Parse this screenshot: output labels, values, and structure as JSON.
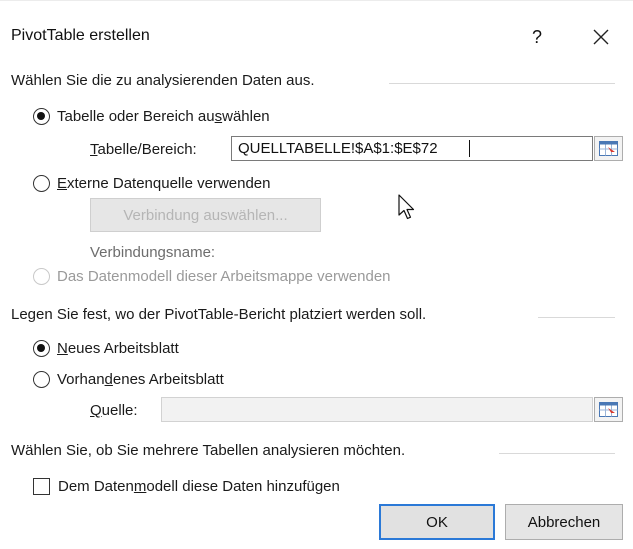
{
  "window": {
    "title": "PivotTable erstellen",
    "help_label": "?"
  },
  "section1": {
    "heading": "Wählen Sie die zu analysierenden Daten aus.",
    "option_table": {
      "label_pre": "Tabelle oder Bereich au",
      "label_ul": "s",
      "label_post": "wählen",
      "checked": true
    },
    "table_range": {
      "label_ul": "T",
      "label_post": "abelle/Bereich:",
      "value": "QUELLTABELLE!$A$1:$E$72"
    },
    "option_external": {
      "label_pre": "",
      "label_ul": "E",
      "label_post": "xterne Datenquelle verwenden",
      "checked": false
    },
    "choose_connection_label": "Verbindung auswählen...",
    "connection_name_label": "Verbindungsname:",
    "option_datamodel": {
      "label": "Das Datenmodell dieser Arbeitsmappe verwenden",
      "checked": false,
      "disabled": true
    }
  },
  "section2": {
    "heading": "Legen Sie fest, wo der PivotTable-Bericht platziert werden soll.",
    "option_new_sheet": {
      "label_pre": "",
      "label_ul": "N",
      "label_post": "eues Arbeitsblatt",
      "checked": true
    },
    "option_existing_sheet": {
      "label_pre": "Vorhan",
      "label_ul": "d",
      "label_post": "enes Arbeitsblatt",
      "checked": false
    },
    "source": {
      "label_ul": "Q",
      "label_post": "uelle:",
      "value": ""
    }
  },
  "section3": {
    "heading": "Wählen Sie, ob Sie mehrere Tabellen analysieren möchten.",
    "checkbox_datamodel": {
      "label_pre": "Dem Daten",
      "label_ul": "m",
      "label_post": "odell diese Daten hinzufügen",
      "checked": false
    }
  },
  "buttons": {
    "ok": "OK",
    "cancel": "Abbrechen"
  },
  "colors": {
    "accent": "#2b79d7",
    "disabled_text": "#b5b5b5",
    "ref_icon_red": "#d9372b"
  },
  "icons": [
    "close-icon",
    "collapse-dialog-icon",
    "mouse-pointer-icon"
  ]
}
